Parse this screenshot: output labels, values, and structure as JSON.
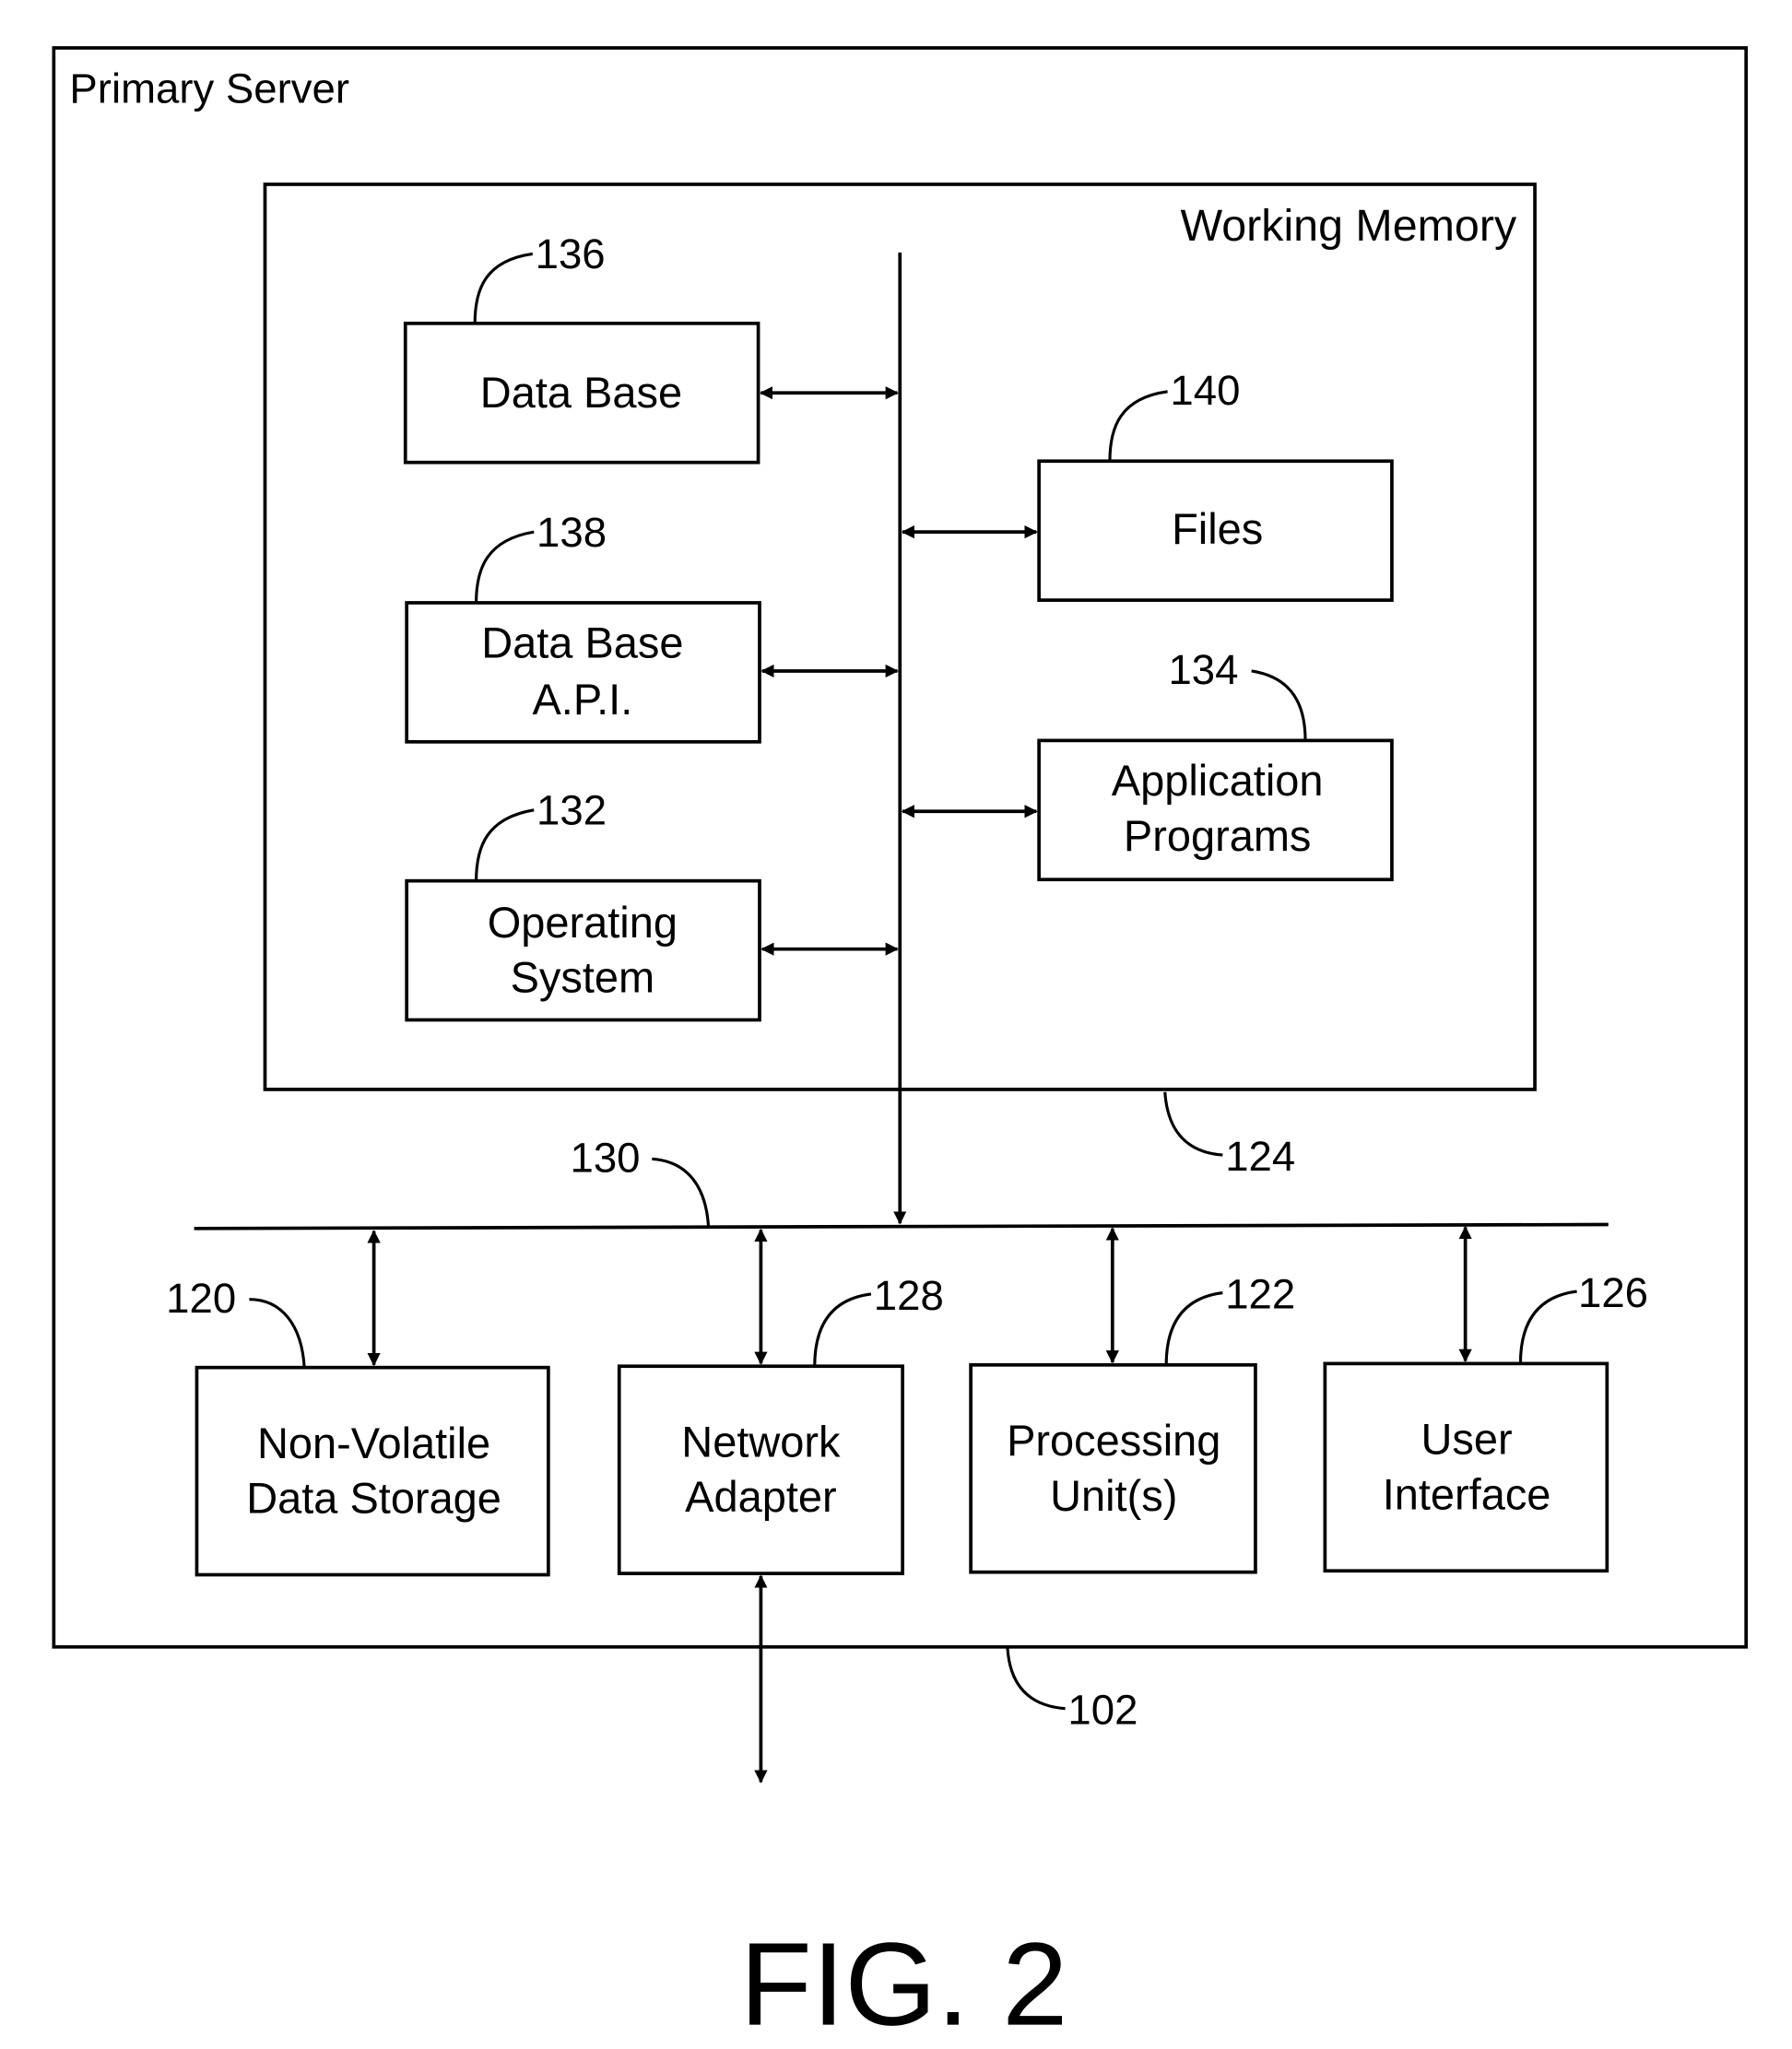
{
  "figure": {
    "caption": "FIG. 2",
    "outer_box": {
      "title": "Primary Server",
      "ref": "102"
    },
    "working_memory": {
      "title": "Working Memory",
      "ref": "124"
    },
    "bus": {
      "ref": "130"
    },
    "memory_components": [
      {
        "id": "database",
        "lines": [
          "Data Base"
        ],
        "ref": "136"
      },
      {
        "id": "database-api",
        "lines": [
          "Data Base",
          "A.P.I."
        ],
        "ref": "138"
      },
      {
        "id": "operating-system",
        "lines": [
          "Operating",
          "System"
        ],
        "ref": "132"
      },
      {
        "id": "files",
        "lines": [
          "Files"
        ],
        "ref": "140"
      },
      {
        "id": "application-programs",
        "lines": [
          "Application",
          "Programs"
        ],
        "ref": "134"
      }
    ],
    "hardware_components": [
      {
        "id": "non-volatile-storage",
        "lines": [
          "Non-Volatile",
          "Data Storage"
        ],
        "ref": "120"
      },
      {
        "id": "network-adapter",
        "lines": [
          "Network",
          "Adapter"
        ],
        "ref": "128"
      },
      {
        "id": "processing-units",
        "lines": [
          "Processing",
          "Unit(s)"
        ],
        "ref": "122"
      },
      {
        "id": "user-interface",
        "lines": [
          "User",
          "Interface"
        ],
        "ref": "126"
      }
    ]
  }
}
